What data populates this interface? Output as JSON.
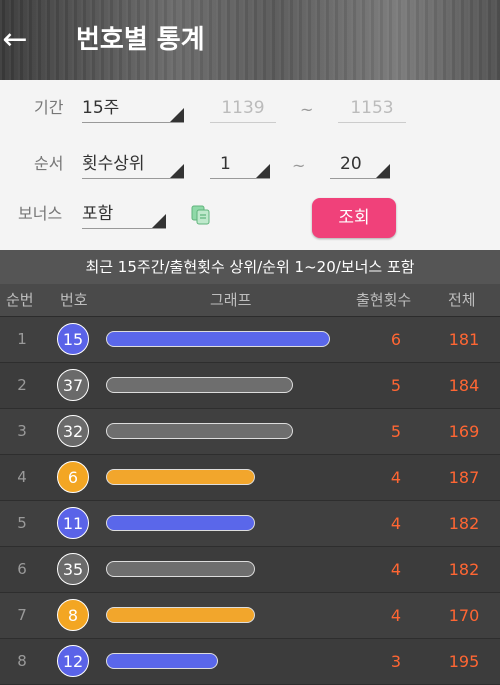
{
  "header": {
    "title": "번호별 통계"
  },
  "filters": {
    "period_label": "기간",
    "period_value": "15주",
    "round_from": "1139",
    "round_to": "1153",
    "tilde": "~",
    "order_label": "순서",
    "order_value": "횟수상위",
    "rank_from": "1",
    "rank_to": "20",
    "bonus_label": "보너스",
    "bonus_value": "포함",
    "search_label": "조회"
  },
  "summary": "최근 15주간/출현횟수 상위/순위 1~20/보너스 포함",
  "table": {
    "columns": {
      "rank": "순번",
      "number": "번호",
      "graph": "그래프",
      "count": "출현횟수",
      "total": "전체"
    },
    "rows": [
      {
        "rank": "1",
        "number": "15",
        "color": "blue",
        "count": 6,
        "total": "181"
      },
      {
        "rank": "2",
        "number": "37",
        "color": "gray",
        "count": 5,
        "total": "184"
      },
      {
        "rank": "3",
        "number": "32",
        "color": "gray",
        "count": 5,
        "total": "169"
      },
      {
        "rank": "4",
        "number": "6",
        "color": "yellow",
        "count": 4,
        "total": "187"
      },
      {
        "rank": "5",
        "number": "11",
        "color": "blue",
        "count": 4,
        "total": "182"
      },
      {
        "rank": "6",
        "number": "35",
        "color": "gray",
        "count": 4,
        "total": "182"
      },
      {
        "rank": "7",
        "number": "8",
        "color": "yellow",
        "count": 4,
        "total": "170"
      },
      {
        "rank": "8",
        "number": "12",
        "color": "blue",
        "count": 3,
        "total": "195"
      }
    ]
  },
  "colors": {
    "blue": {
      "ball": "#5a63e8",
      "bar": "#5a67ea"
    },
    "gray": {
      "ball": "#6a6a6a",
      "bar": "#6e6e6e"
    },
    "yellow": {
      "ball": "#f3a623",
      "bar": "#f2a62c"
    },
    "accent": "#f0417a",
    "count_text": "#ff6633"
  }
}
